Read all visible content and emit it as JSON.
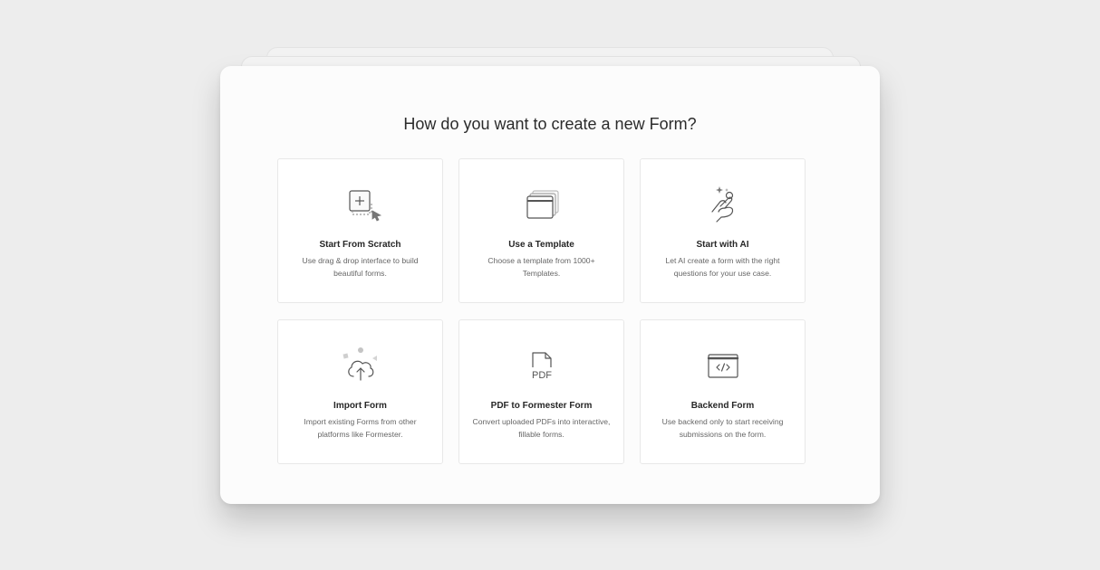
{
  "dialog": {
    "title": "How do you want to create a new Form?"
  },
  "options": [
    {
      "id": "scratch",
      "icon": "add-box-cursor-icon",
      "name": "Start From Scratch",
      "description": "Use drag & drop interface to build beautiful forms."
    },
    {
      "id": "template",
      "icon": "template-stack-icon",
      "name": "Use a Template",
      "description": "Choose a template from 1000+ Templates."
    },
    {
      "id": "ai",
      "icon": "sparkle-hand-icon",
      "name": "Start with AI",
      "description": "Let AI create a form with the right questions for your use case."
    },
    {
      "id": "import",
      "icon": "cloud-upload-icon",
      "name": "Import Form",
      "description": "Import existing Forms from other platforms like Formester."
    },
    {
      "id": "pdf",
      "icon": "pdf-file-icon",
      "name": "PDF to Formester Form",
      "description": "Convert uploaded PDFs into interactive, fillable forms."
    },
    {
      "id": "backend",
      "icon": "code-window-icon",
      "name": "Backend Form",
      "description": "Use backend only to start receiving submissions on the form."
    }
  ],
  "icons": {
    "pdf_label": "PDF"
  },
  "colors": {
    "background": "#ededed",
    "card_border": "#e8e8e8",
    "icon_stroke": "#555555",
    "title_text": "#2b2b2b"
  }
}
